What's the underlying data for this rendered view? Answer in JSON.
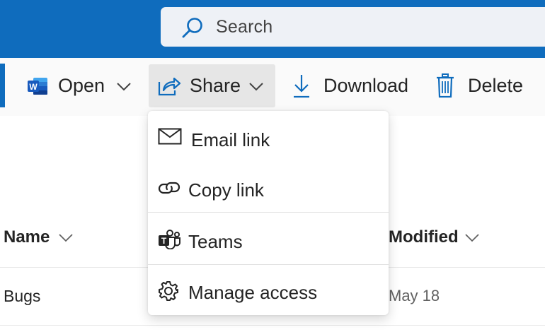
{
  "search": {
    "placeholder": "Search"
  },
  "commandbar": {
    "open_label": "Open",
    "share_label": "Share",
    "download_label": "Download",
    "delete_label": "Delete"
  },
  "share_menu": {
    "items": [
      {
        "label": "Email link",
        "icon": "mail-icon"
      },
      {
        "label": "Copy link",
        "icon": "link-icon"
      },
      {
        "label": "Teams",
        "icon": "teams-icon"
      },
      {
        "label": "Manage access",
        "icon": "gear-icon"
      }
    ]
  },
  "table": {
    "columns": [
      "Name",
      "Modified"
    ],
    "rows": [
      {
        "name": "Bugs",
        "modified": "May 18"
      }
    ]
  },
  "colors": {
    "brand_blue": "#0f6cbd",
    "word_blue": "#185abd"
  }
}
